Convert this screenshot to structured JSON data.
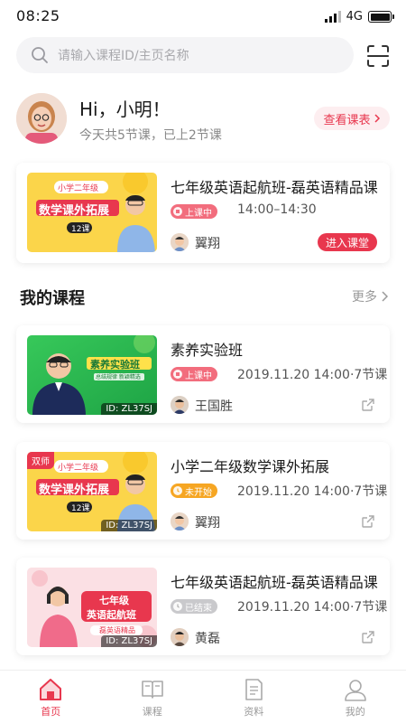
{
  "status_bar": {
    "time": "08:25",
    "network": "4G"
  },
  "search": {
    "placeholder": "请输入课程ID/主页名称"
  },
  "header": {
    "greeting": "Hi，小明！",
    "summary": "今天共5节课，已上2节课",
    "schedule_label": "查看课表"
  },
  "today_course": {
    "title": "七年级英语起航班-磊英语精品课",
    "status": "上课中",
    "time": "14:00–14:30",
    "teacher": "翼翔",
    "enter_label": "进入课堂",
    "thumb": {
      "badge": "小学二年级",
      "headline": "数学课外拓展",
      "lessons": "12课"
    }
  },
  "my_courses": {
    "title": "我的课程",
    "more_label": "更多",
    "items": [
      {
        "title": "素养实验班",
        "status": "上课中",
        "meta": "2019.11.20 14:00·7节课",
        "teacher": "王国胜",
        "id_label": "ID: ZL37SJ",
        "thumb": {
          "headline": "素养实验班",
          "sub": "总结规律 新颖精选"
        }
      },
      {
        "title": "小学二年级数学课外拓展",
        "status": "未开始",
        "meta": "2019.11.20 14:00·7节课",
        "teacher": "翼翔",
        "id_label": "ID: ZL37SJ",
        "tag": "双师",
        "thumb": {
          "badge": "小学二年级",
          "headline": "数学课外拓展",
          "lessons": "12课"
        }
      },
      {
        "title": "七年级英语起航班-磊英语精品课",
        "status": "已结束",
        "meta": "2019.11.20 14:00·7节课",
        "teacher": "黄磊",
        "id_label": "ID: ZL37SJ",
        "thumb": {
          "headline_1": "七年级",
          "headline_2": "英语起航班",
          "sub": "磊英语精品"
        }
      }
    ]
  },
  "tabs": [
    {
      "label": "首页",
      "icon": "home-icon",
      "active": true
    },
    {
      "label": "课程",
      "icon": "book-icon",
      "active": false
    },
    {
      "label": "资料",
      "icon": "document-icon",
      "active": false
    },
    {
      "label": "我的",
      "icon": "user-icon",
      "active": false
    }
  ],
  "colors": {
    "accent": "#e8374e",
    "live": "#f26d7d",
    "pending": "#f6a623",
    "done": "#c9c9cc",
    "thumb_yellow": "#fbd54a",
    "thumb_green": "#2bbf4b",
    "thumb_pink": "#fbe0e4"
  }
}
